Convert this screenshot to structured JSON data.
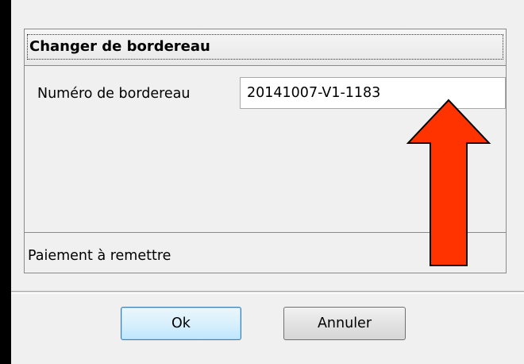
{
  "dialog": {
    "title": "Changer de bordereau",
    "field": {
      "label": "Numéro de bordereau",
      "value": "20141007-V1-1183"
    },
    "status_text": "Paiement à remettre",
    "buttons": {
      "ok_label": "Ok",
      "cancel_label": "Annuler"
    }
  },
  "annotation": {
    "arrow_icon": "up-arrow-icon",
    "fill_color": "#ff3300",
    "stroke_color": "#000000"
  },
  "colors": {
    "window_bg": "#f0f0f0",
    "outer_bg": "#000000"
  }
}
